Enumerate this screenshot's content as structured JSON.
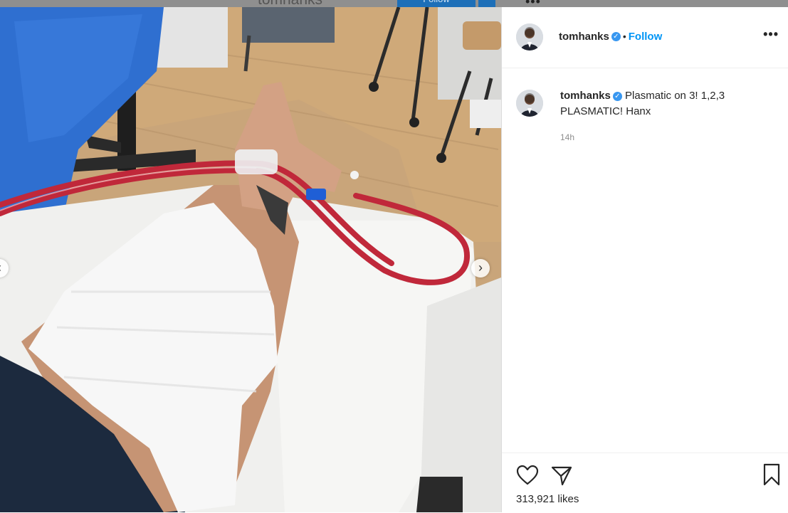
{
  "background_page": {
    "username": "tomhanks",
    "follow_label": "Follow",
    "more_label": "•••"
  },
  "post": {
    "username": "tomhanks",
    "verified": true,
    "separator": "•",
    "follow_label": "Follow",
    "more_label": "•••",
    "caption_username": "tomhanks",
    "caption_text": "Plasmatic on 3! 1,2,3 PLASMATIC! Hanx",
    "timestamp": "14h",
    "likes_text": "313,921 likes",
    "icons": [
      "heart-icon",
      "share-icon",
      "bookmark-icon",
      "verified-badge-icon",
      "more-icon",
      "chevron-left-icon",
      "chevron-right-icon"
    ]
  },
  "carousel": {
    "prev_label": "‹",
    "next_label": "›"
  },
  "colors": {
    "link_blue": "#0095f6",
    "verified_blue": "#3897f0",
    "tube_red": "#c0283a"
  }
}
